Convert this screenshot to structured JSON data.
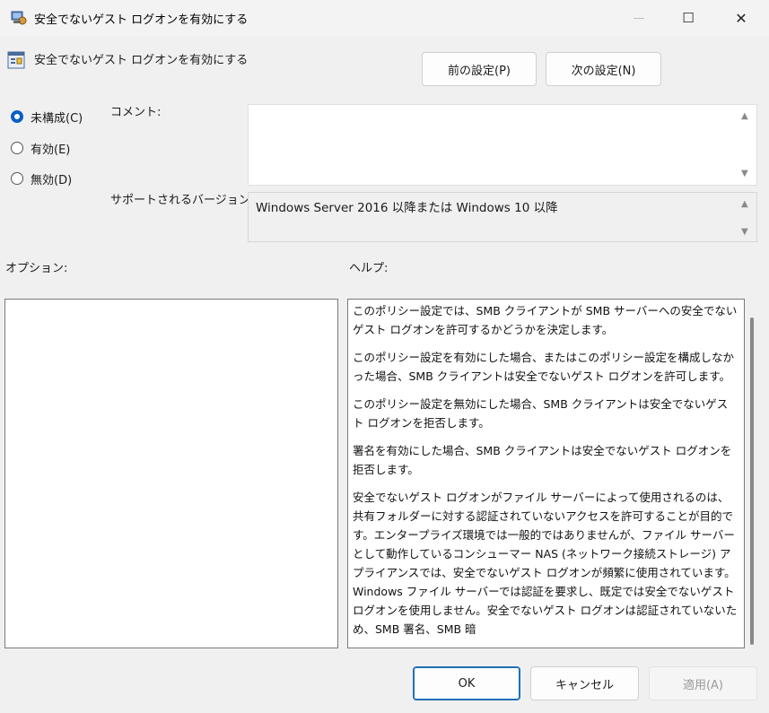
{
  "window": {
    "title": "安全でないゲスト ログオンを有効にする",
    "controls": {
      "minimize": "—",
      "maximize": "☐",
      "close": "✕"
    }
  },
  "header": {
    "policy_title": "安全でないゲスト ログオンを有効にする",
    "prev_button": "前の設定(P)",
    "next_button": "次の設定(N)"
  },
  "state": {
    "options": [
      {
        "label": "未構成(C)",
        "checked": true
      },
      {
        "label": "有効(E)",
        "checked": false
      },
      {
        "label": "無効(D)",
        "checked": false
      }
    ]
  },
  "comment": {
    "label": "コメント:",
    "value": ""
  },
  "supported": {
    "label": "サポートされるバージョン:",
    "value": "Windows Server 2016 以降または Windows 10 以降"
  },
  "options_section": {
    "label": "オプション:"
  },
  "help_section": {
    "label": "ヘルプ:",
    "paragraphs": [
      "このポリシー設定では、SMB クライアントが SMB サーバーへの安全でないゲスト ログオンを許可するかどうかを決定します。",
      "このポリシー設定を有効にした場合、またはこのポリシー設定を構成しなかった場合、SMB クライアントは安全でないゲスト ログオンを許可します。",
      "このポリシー設定を無効にした場合、SMB クライアントは安全でないゲスト ログオンを拒否します。",
      "署名を有効にした場合、SMB クライアントは安全でないゲスト ログオンを拒否します。",
      "安全でないゲスト ログオンがファイル サーバーによって使用されるのは、共有フォルダーに対する認証されていないアクセスを許可することが目的です。エンタープライズ環境では一般的ではありませんが、ファイル サーバーとして動作しているコンシューマー NAS (ネットワーク接続ストレージ) アプライアンスでは、安全でないゲスト ログオンが頻繁に使用されています。Windows ファイル サーバーでは認証を要求し、既定では安全でないゲスト ログオンを使用しません。安全でないゲスト ログオンは認証されていないため、SMB 署名、SMB 暗"
    ]
  },
  "footer": {
    "ok": "OK",
    "cancel": "キャンセル",
    "apply": "適用(A)"
  },
  "colors": {
    "accent": "#0a5fc4"
  }
}
